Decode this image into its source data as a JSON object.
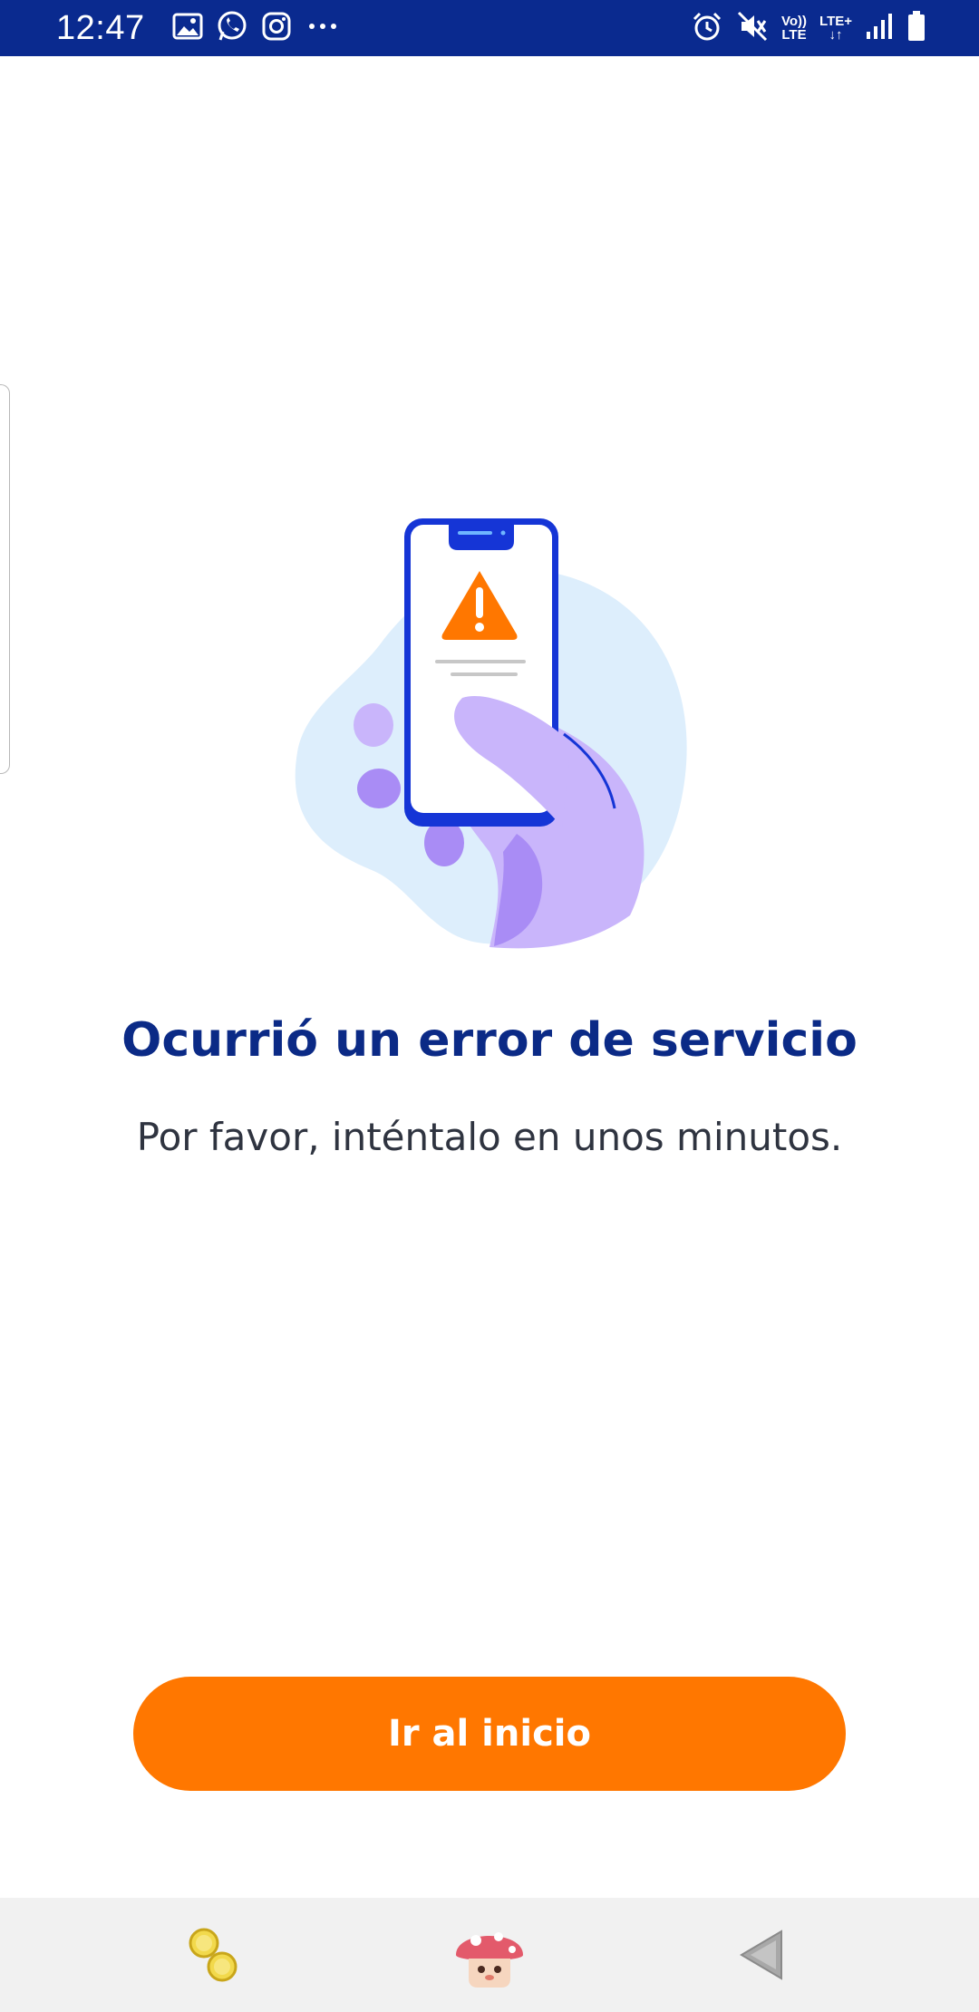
{
  "status_bar": {
    "time": "12:47",
    "left_icons": [
      "gallery-icon",
      "whatsapp-icon",
      "instagram-icon",
      "more-dots-icon"
    ],
    "right_icons": [
      "alarm-icon",
      "mute-icon",
      "volte-icon",
      "lte-plus-icon",
      "signal-icon",
      "battery-icon"
    ],
    "volte_top": "Vo))",
    "volte_bottom": "LTE",
    "lte_plus": "LTE+",
    "bg_color": "#0a2a8f"
  },
  "main": {
    "title": "Ocurrió un error de servicio",
    "subtitle": "Por favor, inténtalo en unos minutos.",
    "button_label": "Ir al inicio",
    "accent_color": "#ff7700",
    "title_color": "#0b2a86"
  },
  "illustration": {
    "icon": "phone-warning-illustration"
  },
  "nav_bar": {
    "items": [
      "coins-icon",
      "mushroom-icon",
      "back-triangle-icon"
    ]
  }
}
